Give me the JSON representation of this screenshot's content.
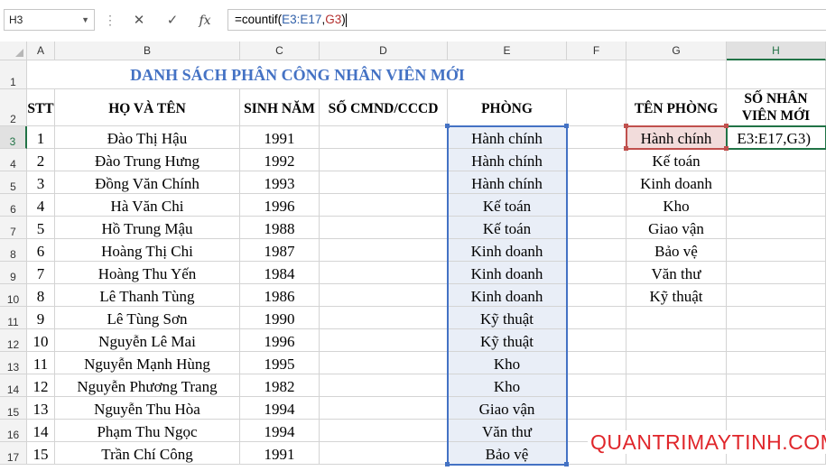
{
  "formula_bar": {
    "name_box": "H3",
    "cancel_icon": "✕",
    "enter_icon": "✓",
    "fx_label": "fx",
    "formula_prefix": "=countif(",
    "formula_ref1": "E3:E17",
    "formula_comma": ",",
    "formula_ref2": "G3",
    "formula_suffix": ")"
  },
  "columns": [
    "A",
    "B",
    "C",
    "D",
    "E",
    "F",
    "G",
    "H"
  ],
  "rows": [
    "1",
    "2",
    "3",
    "4",
    "5",
    "6",
    "7",
    "8",
    "9",
    "10",
    "11",
    "12",
    "13",
    "14",
    "15",
    "16",
    "17"
  ],
  "sheet": {
    "title": "DANH SÁCH PHÂN CÔNG NHÂN VIÊN MỚI",
    "headers": {
      "stt": "STT",
      "name": "HỌ VÀ TÊN",
      "year": "SINH NĂM",
      "id": "SỐ CMND/CCCD",
      "dept": "PHÒNG",
      "dept_name": "TÊN PHÒNG",
      "count_line1": "SỐ NHÂN",
      "count_line2": "VIÊN MỚI"
    },
    "employees": [
      {
        "stt": "1",
        "name": "Đào Thị Hậu",
        "year": "1991",
        "dept": "Hành chính"
      },
      {
        "stt": "2",
        "name": "Đào Trung Hưng",
        "year": "1992",
        "dept": "Hành chính"
      },
      {
        "stt": "3",
        "name": "Đồng Văn Chính",
        "year": "1993",
        "dept": "Hành chính"
      },
      {
        "stt": "4",
        "name": "Hà Văn Chi",
        "year": "1996",
        "dept": "Kế toán"
      },
      {
        "stt": "5",
        "name": "Hồ Trung Mậu",
        "year": "1988",
        "dept": "Kế toán"
      },
      {
        "stt": "6",
        "name": "Hoàng Thị Chi",
        "year": "1987",
        "dept": "Kinh doanh"
      },
      {
        "stt": "7",
        "name": "Hoàng Thu Yến",
        "year": "1984",
        "dept": "Kinh doanh"
      },
      {
        "stt": "8",
        "name": "Lê Thanh Tùng",
        "year": "1986",
        "dept": "Kinh doanh"
      },
      {
        "stt": "9",
        "name": "Lê Tùng Sơn",
        "year": "1990",
        "dept": "Kỹ thuật"
      },
      {
        "stt": "10",
        "name": "Nguyễn Lê Mai",
        "year": "1996",
        "dept": "Kỹ thuật"
      },
      {
        "stt": "11",
        "name": "Nguyễn Mạnh Hùng",
        "year": "1995",
        "dept": "Kho"
      },
      {
        "stt": "12",
        "name": "Nguyễn Phương Trang",
        "year": "1982",
        "dept": "Kho"
      },
      {
        "stt": "13",
        "name": "Nguyễn Thu Hòa",
        "year": "1994",
        "dept": "Giao vận"
      },
      {
        "stt": "14",
        "name": "Phạm Thu Ngọc",
        "year": "1994",
        "dept": "Văn thư"
      },
      {
        "stt": "15",
        "name": "Trần Chí Công",
        "year": "1991",
        "dept": "Bảo vệ"
      }
    ],
    "departments": [
      "Hành chính",
      "Kế toán",
      "Kinh doanh",
      "Kho",
      "Giao vận",
      "Bảo vệ",
      "Văn thư",
      "Kỹ thuật"
    ],
    "h3_display": "E3:E17,G3)"
  },
  "watermark": "QUANTRIMAYTINH.COM",
  "colors": {
    "title": "#4472c4",
    "ref1_border": "#4472c4",
    "ref2_border": "#c0504d",
    "active_cell": "#217346",
    "watermark": "#e0262b"
  }
}
